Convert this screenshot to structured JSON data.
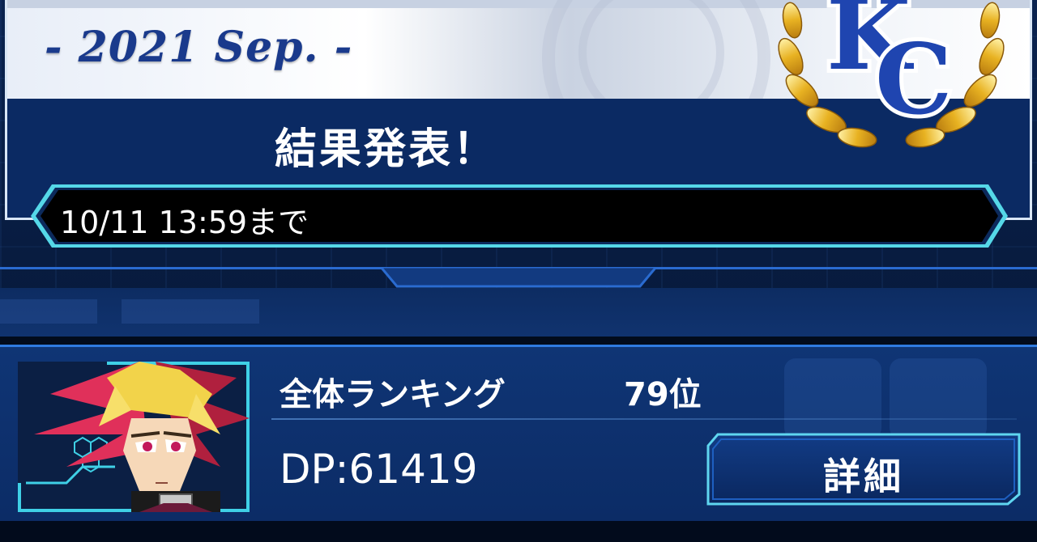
{
  "event": {
    "month_label": "- 2021 Sep. -",
    "title": "結果発表！",
    "emblem_text": "KC",
    "deadline": "10/11 13:59まで"
  },
  "player": {
    "ranking_label": "全体ランキング",
    "ranking_value": "79位",
    "dp": "DP:61419",
    "detail_button_label": "詳細"
  },
  "icons": {
    "emblem": "laurel-kc-emblem-icon",
    "avatar": "duelist-portrait-icon"
  },
  "colors": {
    "accent_blue": "#1a3a8c",
    "panel_blue": "#0f3575",
    "highlight_cyan": "#3fd0e6",
    "gold": "#e8b222"
  }
}
